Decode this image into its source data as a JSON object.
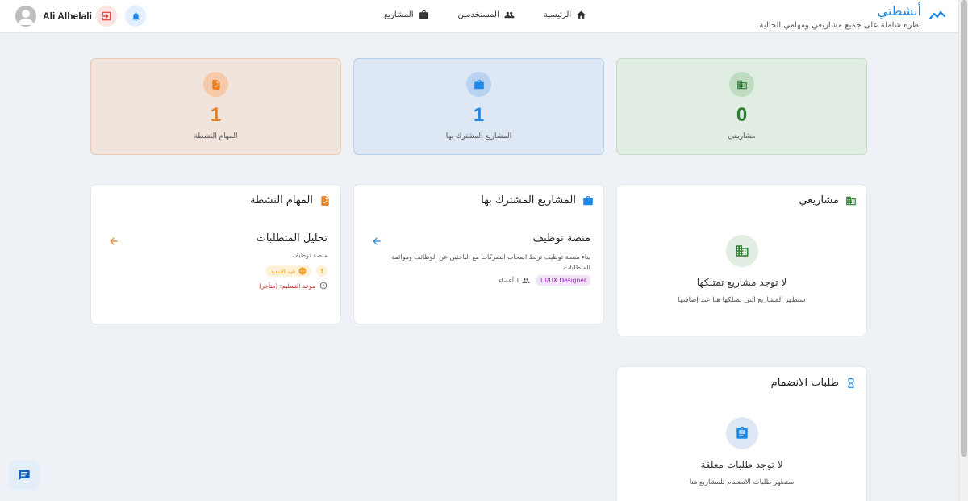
{
  "header": {
    "brand_title": "أنشطتي",
    "brand_subtitle": "نظرة شاملة على جميع مشاريعي ومهامي الحالية",
    "nav": [
      {
        "label": "الرئيسية",
        "icon": "home-icon"
      },
      {
        "label": "المستخدمين",
        "icon": "users-icon"
      },
      {
        "label": "المشاريع",
        "icon": "briefcase-icon"
      }
    ],
    "user_name": "Ali Alhelali"
  },
  "stats": {
    "mine": {
      "value": "0",
      "label": "مشاريعي"
    },
    "shared": {
      "value": "1",
      "label": "المشاريع المشترك بها"
    },
    "tasks": {
      "value": "1",
      "label": "المهام النشطة"
    }
  },
  "panels": {
    "mine": {
      "title": "مشاريعي",
      "empty_title": "لا توجد مشاريع تمتلكها",
      "empty_subtitle": "ستظهر المشاريع التي تمتلكها هنا عند إضافتها"
    },
    "shared": {
      "title": "المشاريع المشترك بها",
      "item": {
        "title": "منصة توظيف",
        "description": "بناء منصة توظيف تربط اصحاب الشركات مع الباحثين عن الوظائف وموائمة المتطلبات",
        "role": "UI/UX Designer",
        "members": "1 أعضاء"
      }
    },
    "tasks": {
      "title": "المهام النشطة",
      "item": {
        "title": "تحليل المتطلبات",
        "project": "منصة توظيف",
        "status": "قيد التنفيذ",
        "warning": "!",
        "due": "موعد التسليم: (متأخر)"
      }
    },
    "join": {
      "title": "طلبات الانضمام",
      "empty_title": "لا توجد طلبات معلقة",
      "empty_subtitle": "ستظهر طلبات الانضمام للمشاريع هنا"
    }
  },
  "colors": {
    "accent": "#1e88e5",
    "tasks": "#e67e22",
    "mine": "#2e7d32",
    "overdue": "#c62828"
  }
}
